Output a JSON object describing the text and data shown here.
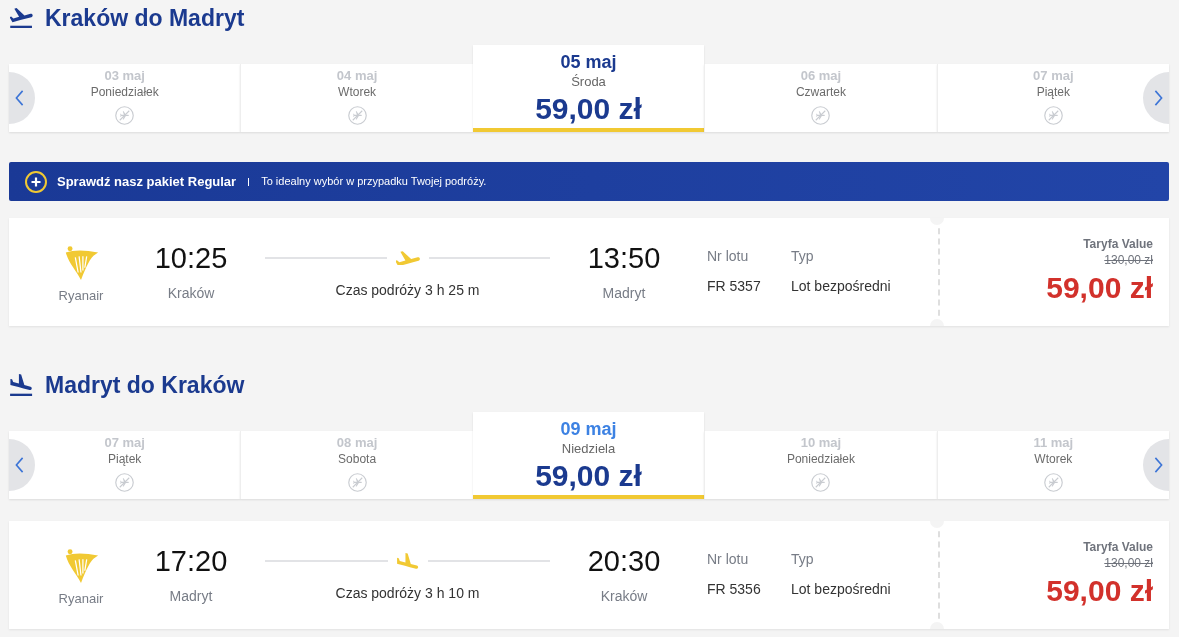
{
  "legs": [
    {
      "kind": "outbound",
      "title": "Kraków do Madryt",
      "days": [
        {
          "date": "03 maj",
          "weekday": "Poniedziałek",
          "selected": false,
          "hovered": false
        },
        {
          "date": "04 maj",
          "weekday": "Wtorek",
          "selected": false,
          "hovered": false
        },
        {
          "date": "05 maj",
          "weekday": "Środa",
          "price": "59,00 zł",
          "selected": true,
          "hovered": false
        },
        {
          "date": "06 maj",
          "weekday": "Czwartek",
          "selected": false,
          "hovered": false
        },
        {
          "date": "07 maj",
          "weekday": "Piątek",
          "selected": false,
          "hovered": false
        }
      ],
      "promo_banner": {
        "title": "Sprawdź nasz pakiet Regular",
        "text": "To idealny wybór w przypadku Twojej podróży."
      },
      "flight": {
        "airline": "Ryanair",
        "departure_time": "10:25",
        "departure_city": "Kraków",
        "duration": "Czas podróży 3 h 25 m",
        "arrival_time": "13:50",
        "arrival_city": "Madryt",
        "flight_number_label": "Nr lotu",
        "flight_number": "FR 5357",
        "type_label": "Typ",
        "type": "Lot bezpośredni",
        "fare_name": "Taryfa Value",
        "old_price": "130,00 zł",
        "price": "59,00 zł"
      }
    },
    {
      "kind": "inbound",
      "title": "Madryt do Kraków",
      "days": [
        {
          "date": "07 maj",
          "weekday": "Piątek",
          "selected": false,
          "hovered": false
        },
        {
          "date": "08 maj",
          "weekday": "Sobota",
          "selected": false,
          "hovered": false
        },
        {
          "date": "09 maj",
          "weekday": "Niedziela",
          "price": "59,00 zł",
          "selected": true,
          "hovered": true
        },
        {
          "date": "10 maj",
          "weekday": "Poniedziałek",
          "selected": false,
          "hovered": false
        },
        {
          "date": "11 maj",
          "weekday": "Wtorek",
          "selected": false,
          "hovered": false
        }
      ],
      "flight": {
        "airline": "Ryanair",
        "departure_time": "17:20",
        "departure_city": "Madryt",
        "duration": "Czas podróży 3 h 10 m",
        "arrival_time": "20:30",
        "arrival_city": "Kraków",
        "flight_number_label": "Nr lotu",
        "flight_number": "FR 5356",
        "type_label": "Typ",
        "type": "Lot bezpośredni",
        "fare_name": "Taryfa Value",
        "old_price": "130,00 zł",
        "price": "59,00 zł"
      }
    }
  ]
}
